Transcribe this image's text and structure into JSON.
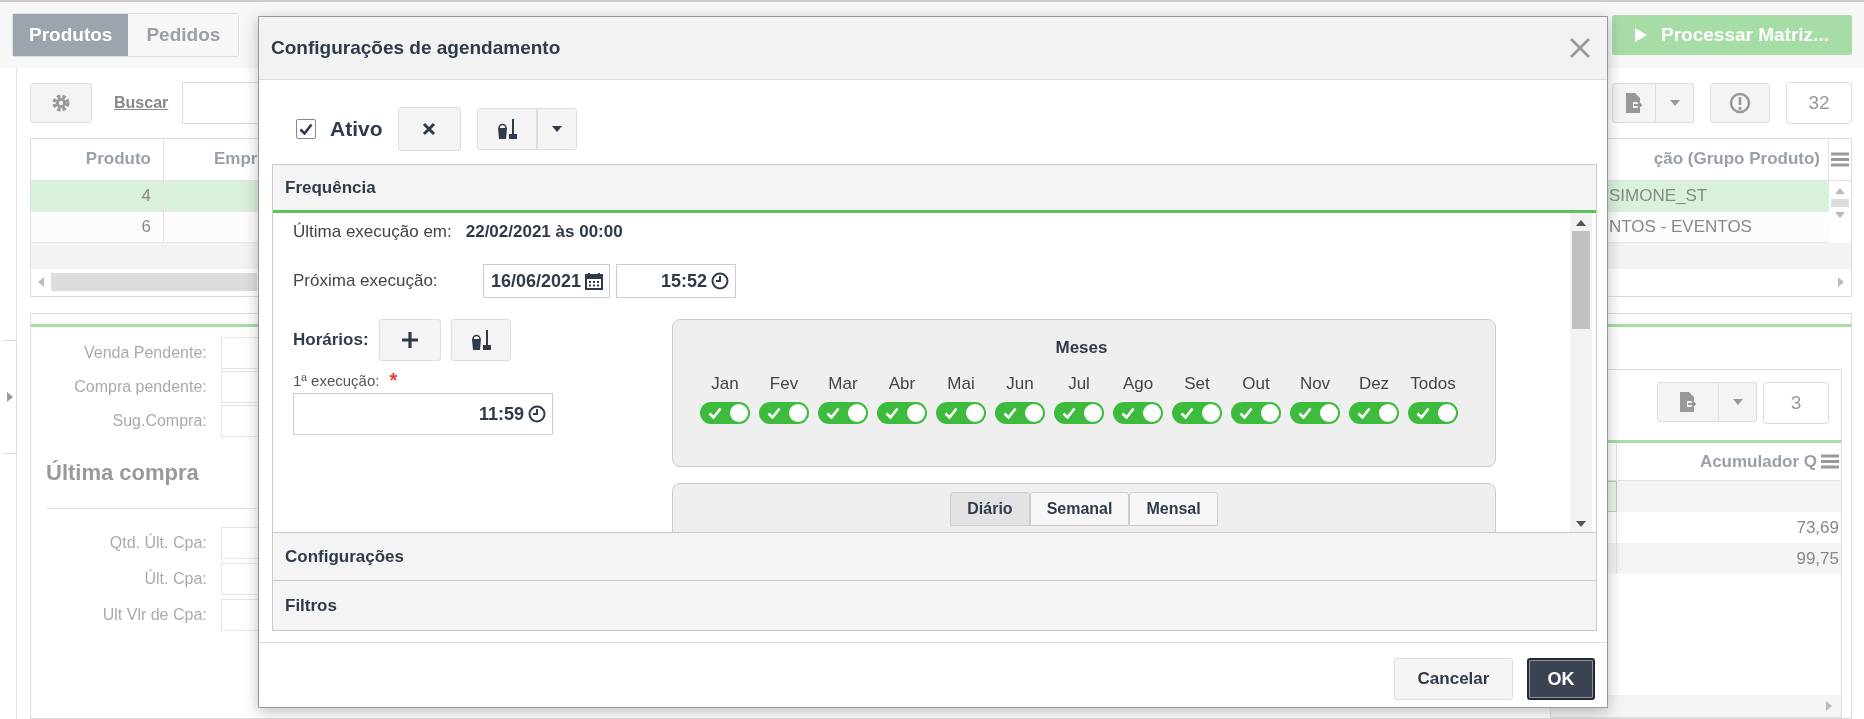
{
  "page_tabs": [
    {
      "label": "Produtos",
      "selected": true
    },
    {
      "label": "Pedidos",
      "selected": false
    }
  ],
  "process_button": {
    "label": "Processar Matriz..."
  },
  "toolbar": {
    "search_link": "Buscar",
    "count": "32"
  },
  "products_table": {
    "columns": [
      "Produto",
      "Empr",
      "ção (Grupo Produto)"
    ],
    "rows": [
      {
        "produto": "4",
        "grupo": "SIMONE_ST",
        "selected": true
      },
      {
        "produto": "6",
        "grupo": "NTOS - EVENTOS",
        "selected": false
      }
    ]
  },
  "detail_panel": {
    "fields": [
      "Venda Pendente:",
      "Compra pendente:",
      "Sug.Compra:"
    ],
    "section_title": "Última compra",
    "purchase_fields": [
      "Qtd. Últ. Cpa:",
      "Últ. Cpa:",
      "Ult Vlr de Cpa:"
    ]
  },
  "detail_table": {
    "count": "3",
    "columns": [
      "Acumulador Q"
    ],
    "rows": [
      {
        "value": "73,69"
      },
      {
        "value": "99,75"
      }
    ]
  },
  "dialog": {
    "title": "Configurações de agendamento",
    "active": {
      "label": "Ativo",
      "checked": true
    },
    "sections": [
      {
        "title": "Frequência",
        "expanded": true
      },
      {
        "title": "Configurações",
        "expanded": false
      },
      {
        "title": "Filtros",
        "expanded": false
      }
    ],
    "frequency": {
      "last_run_label": "Última execução em:",
      "last_run_value": "22/02/2021 às 00:00",
      "next_run_label": "Próxima execução:",
      "next_date": "16/06/2021",
      "next_time": "15:52",
      "schedules_label": "Horários:",
      "first_run_label": "1ª execução:",
      "required_mark": "*",
      "first_run_time": "11:59",
      "months_title": "Meses",
      "months": [
        {
          "label": "Jan",
          "on": true
        },
        {
          "label": "Fev",
          "on": true
        },
        {
          "label": "Mar",
          "on": true
        },
        {
          "label": "Abr",
          "on": true
        },
        {
          "label": "Mai",
          "on": true
        },
        {
          "label": "Jun",
          "on": true
        },
        {
          "label": "Jul",
          "on": true
        },
        {
          "label": "Ago",
          "on": true
        },
        {
          "label": "Set",
          "on": true
        },
        {
          "label": "Out",
          "on": true
        },
        {
          "label": "Nov",
          "on": true
        },
        {
          "label": "Dez",
          "on": true
        },
        {
          "label": "Todos",
          "on": true
        }
      ],
      "period_tabs": [
        {
          "label": "Diário",
          "selected": true
        },
        {
          "label": "Semanal",
          "selected": false
        },
        {
          "label": "Mensal",
          "selected": false
        }
      ]
    },
    "buttons": {
      "cancel": "Cancelar",
      "ok": "OK"
    }
  }
}
